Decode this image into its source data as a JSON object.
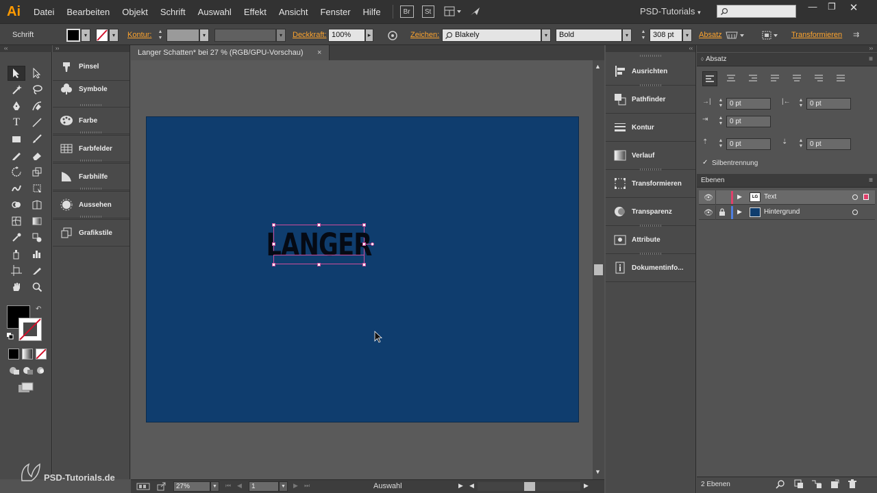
{
  "app": {
    "logo": "Ai",
    "workspace": "PSD-Tutorials",
    "brand_footer": "PSD-Tutorials.de"
  },
  "menu": [
    "Datei",
    "Bearbeiten",
    "Objekt",
    "Schrift",
    "Auswahl",
    "Effekt",
    "Ansicht",
    "Fenster",
    "Hilfe"
  ],
  "menubar_buttons": {
    "bridge": "Br",
    "stock": "St"
  },
  "control_bar": {
    "selection_type": "Schrift",
    "stroke_label": "Kontur:",
    "opacity_label": "Deckkraft:",
    "opacity_value": "100%",
    "character_label": "Zeichen:",
    "font_family": "Blakely",
    "font_style": "Bold",
    "font_size": "308 pt",
    "paragraph_link": "Absatz",
    "transform_link": "Transformieren"
  },
  "document": {
    "tab_title": "Langer Schatten* bei 27 % (RGB/GPU-Vorschau)",
    "close_glyph": "×",
    "artboard_text": "LANGER",
    "artboard_color": "#0f3d6e"
  },
  "status_bar": {
    "zoom": "27%",
    "page": "1",
    "tool_status": "Auswahl"
  },
  "left_panels": [
    {
      "label": "Pinsel",
      "icon": "brush-icon"
    },
    {
      "label": "Symbole",
      "icon": "club-icon"
    },
    {
      "label": "Farbe",
      "icon": "palette-icon"
    },
    {
      "label": "Farbfelder",
      "icon": "grid-icon"
    },
    {
      "label": "Farbhilfe",
      "icon": "color-guide-icon"
    },
    {
      "label": "Aussehen",
      "icon": "appearance-icon"
    },
    {
      "label": "Grafikstile",
      "icon": "graphic-styles-icon"
    }
  ],
  "mid_panels": [
    {
      "label": "Ausrichten",
      "icon": "align-icon"
    },
    {
      "label": "Pathfinder",
      "icon": "pathfinder-icon"
    },
    {
      "label": "Kontur",
      "icon": "stroke-icon"
    },
    {
      "label": "Verlauf",
      "icon": "gradient-icon"
    },
    {
      "label": "Transformieren",
      "icon": "transform-icon"
    },
    {
      "label": "Transparenz",
      "icon": "transparency-icon"
    },
    {
      "label": "Attribute",
      "icon": "attributes-icon"
    },
    {
      "label": "Dokumentinfo...",
      "icon": "document-info-icon"
    }
  ],
  "paragraph_panel": {
    "title": "Absatz",
    "indent_left": "0 pt",
    "indent_right": "0 pt",
    "first_line": "0 pt",
    "space_before": "0 pt",
    "space_after": "0 pt",
    "hyphenation_label": "Silbentrennung",
    "hyphenation_checked": true
  },
  "layers_panel": {
    "title": "Ebenen",
    "layers": [
      {
        "name": "Text",
        "color": "#e0406b",
        "locked": false
      },
      {
        "name": "Hintergrund",
        "color": "#4f7fe0",
        "locked": true
      }
    ],
    "count": "2 Ebenen"
  }
}
